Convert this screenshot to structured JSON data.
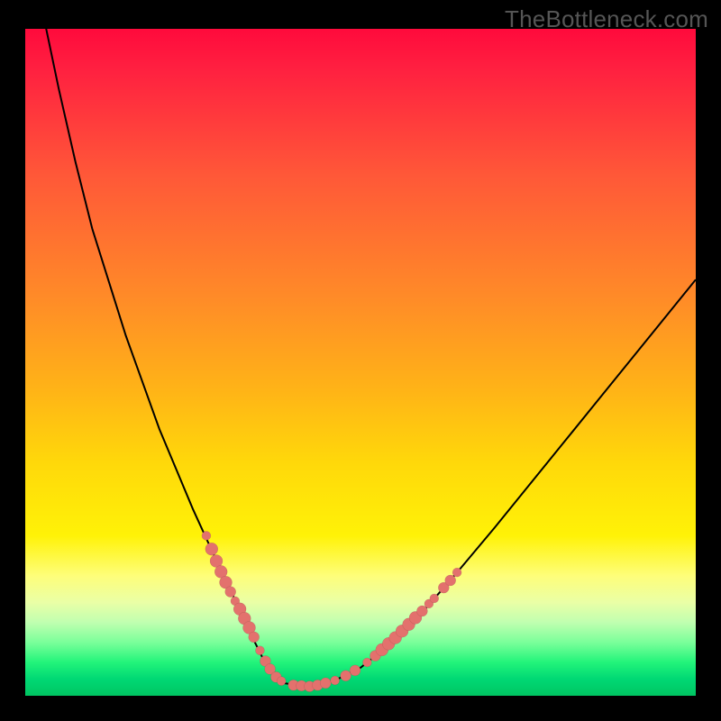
{
  "watermark": "TheBottleneck.com",
  "colors": {
    "frame": "#000000",
    "curve": "#000000",
    "dots": "#e3716d",
    "gradient_top": "#ff0a3c",
    "gradient_bottom": "#00c562"
  },
  "chart_data": {
    "type": "line",
    "title": "",
    "xlabel": "",
    "ylabel": "",
    "xlim": [
      0,
      100
    ],
    "ylim": [
      0,
      100
    ],
    "x": [
      0,
      2.5,
      5,
      7.5,
      10,
      12.5,
      15,
      17.5,
      20,
      22.5,
      25,
      27.5,
      30,
      32.5,
      34,
      35.5,
      37,
      37.8,
      42,
      46,
      50,
      55,
      60,
      65,
      70,
      75,
      80,
      85,
      90,
      95,
      100
    ],
    "y": [
      118,
      103,
      91,
      80,
      70,
      62,
      54,
      47,
      40,
      34,
      28,
      22.5,
      17,
      12,
      8.5,
      5.5,
      3,
      2,
      1.4,
      2.2,
      4.2,
      8.2,
      13.4,
      19.2,
      25.2,
      31.4,
      37.6,
      43.8,
      50,
      56.2,
      62.4
    ],
    "series": [
      {
        "name": "bottleneck-curve",
        "note": "V-shaped curve; y in percent of plot height from bottom; values >100 extend above visible area",
        "x": [
          0,
          2.5,
          5,
          7.5,
          10,
          12.5,
          15,
          17.5,
          20,
          22.5,
          25,
          27.5,
          30,
          32.5,
          34,
          35.5,
          37,
          37.8,
          42,
          46,
          50,
          55,
          60,
          65,
          70,
          75,
          80,
          85,
          90,
          95,
          100
        ],
        "y": [
          118,
          103,
          91,
          80,
          70,
          62,
          54,
          47,
          40,
          34,
          28,
          22.5,
          17,
          12,
          8.5,
          5.5,
          3,
          2,
          1.4,
          2.2,
          4.2,
          8.2,
          13.4,
          19.2,
          25.2,
          31.4,
          37.6,
          43.8,
          50,
          56.2,
          62.4
        ]
      }
    ],
    "markers": {
      "note": "salmon dot clusters along the curve near the valley; y is percent from bottom",
      "points": [
        {
          "x": 27.0,
          "y": 24.0,
          "r": 5
        },
        {
          "x": 27.8,
          "y": 22.0,
          "r": 7
        },
        {
          "x": 28.5,
          "y": 20.2,
          "r": 7
        },
        {
          "x": 29.2,
          "y": 18.6,
          "r": 7
        },
        {
          "x": 29.9,
          "y": 17.0,
          "r": 7
        },
        {
          "x": 30.6,
          "y": 15.6,
          "r": 6
        },
        {
          "x": 31.3,
          "y": 14.2,
          "r": 5
        },
        {
          "x": 32.0,
          "y": 13.0,
          "r": 7
        },
        {
          "x": 32.7,
          "y": 11.6,
          "r": 7
        },
        {
          "x": 33.4,
          "y": 10.2,
          "r": 7
        },
        {
          "x": 34.1,
          "y": 8.8,
          "r": 6
        },
        {
          "x": 35.0,
          "y": 6.8,
          "r": 5
        },
        {
          "x": 35.8,
          "y": 5.2,
          "r": 6
        },
        {
          "x": 36.5,
          "y": 4.0,
          "r": 6
        },
        {
          "x": 37.4,
          "y": 2.8,
          "r": 6
        },
        {
          "x": 38.2,
          "y": 2.2,
          "r": 5
        },
        {
          "x": 40.0,
          "y": 1.6,
          "r": 6
        },
        {
          "x": 41.2,
          "y": 1.5,
          "r": 6
        },
        {
          "x": 42.4,
          "y": 1.4,
          "r": 6
        },
        {
          "x": 43.6,
          "y": 1.6,
          "r": 6
        },
        {
          "x": 44.8,
          "y": 1.9,
          "r": 6
        },
        {
          "x": 46.2,
          "y": 2.3,
          "r": 5
        },
        {
          "x": 47.8,
          "y": 3.0,
          "r": 6
        },
        {
          "x": 49.2,
          "y": 3.8,
          "r": 6
        },
        {
          "x": 51.0,
          "y": 5.0,
          "r": 5
        },
        {
          "x": 52.2,
          "y": 6.0,
          "r": 6
        },
        {
          "x": 53.2,
          "y": 6.9,
          "r": 7
        },
        {
          "x": 54.2,
          "y": 7.8,
          "r": 7
        },
        {
          "x": 55.2,
          "y": 8.7,
          "r": 7
        },
        {
          "x": 56.2,
          "y": 9.7,
          "r": 7
        },
        {
          "x": 57.2,
          "y": 10.7,
          "r": 7
        },
        {
          "x": 58.2,
          "y": 11.7,
          "r": 7
        },
        {
          "x": 59.2,
          "y": 12.7,
          "r": 6
        },
        {
          "x": 60.2,
          "y": 13.8,
          "r": 5
        },
        {
          "x": 61.0,
          "y": 14.6,
          "r": 5
        },
        {
          "x": 62.4,
          "y": 16.2,
          "r": 6
        },
        {
          "x": 63.4,
          "y": 17.3,
          "r": 6
        },
        {
          "x": 64.4,
          "y": 18.5,
          "r": 5
        }
      ]
    }
  }
}
